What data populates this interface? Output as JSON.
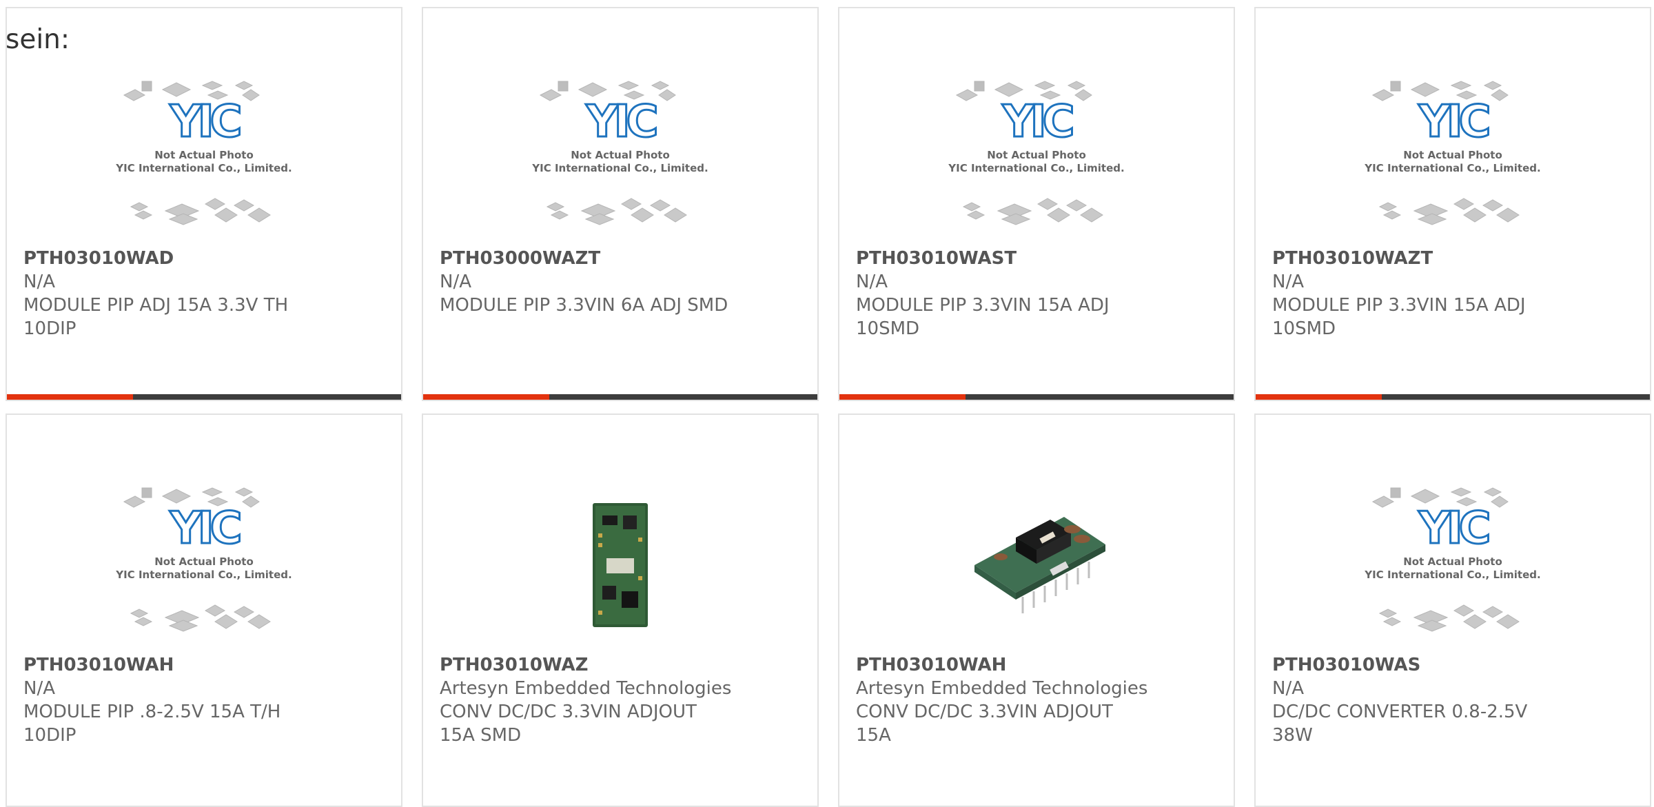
{
  "page": {
    "intro_text": "sein:"
  },
  "products": [
    {
      "part": "PTH03010WAD",
      "manufacturer": "N/A",
      "description": "MODULE PIP ADJ 15A 3.3V TH 10DIP",
      "image": "placeholder"
    },
    {
      "part": "PTH03000WAZT",
      "manufacturer": "N/A",
      "description": "MODULE PIP 3.3VIN 6A ADJ SMD",
      "image": "placeholder"
    },
    {
      "part": "PTH03010WAST",
      "manufacturer": "N/A",
      "description": "MODULE PIP 3.3VIN 15A ADJ 10SMD",
      "image": "placeholder"
    },
    {
      "part": "PTH03010WAZT",
      "manufacturer": "N/A",
      "description": "MODULE PIP 3.3VIN 15A ADJ 10SMD",
      "image": "placeholder"
    },
    {
      "part": "PTH03010WAH",
      "manufacturer": "N/A",
      "description": "MODULE PIP .8-2.5V 15A T/H 10DIP",
      "image": "placeholder"
    },
    {
      "part": "PTH03010WAZ",
      "manufacturer": "Artesyn Embedded Technologies",
      "description": "CONV DC/DC 3.3VIN ADJOUT 15A SMD",
      "image": "pcb-vertical"
    },
    {
      "part": "PTH03010WAH",
      "manufacturer": "Artesyn Embedded Technologies",
      "description": "CONV DC/DC 3.3VIN ADJOUT 15A",
      "image": "pcb-module"
    },
    {
      "part": "PTH03010WAS",
      "manufacturer": "N/A",
      "description": "DC/DC CONVERTER 0.8-2.5V 38W",
      "image": "placeholder"
    }
  ],
  "placeholder": {
    "logo": "YIC",
    "line1": "Not Actual Photo",
    "line2": "YIC International Co., Limited."
  },
  "colors": {
    "accent": "#e3330f",
    "bar": "#3d3d3d",
    "logo_blue": "#1e73be"
  }
}
